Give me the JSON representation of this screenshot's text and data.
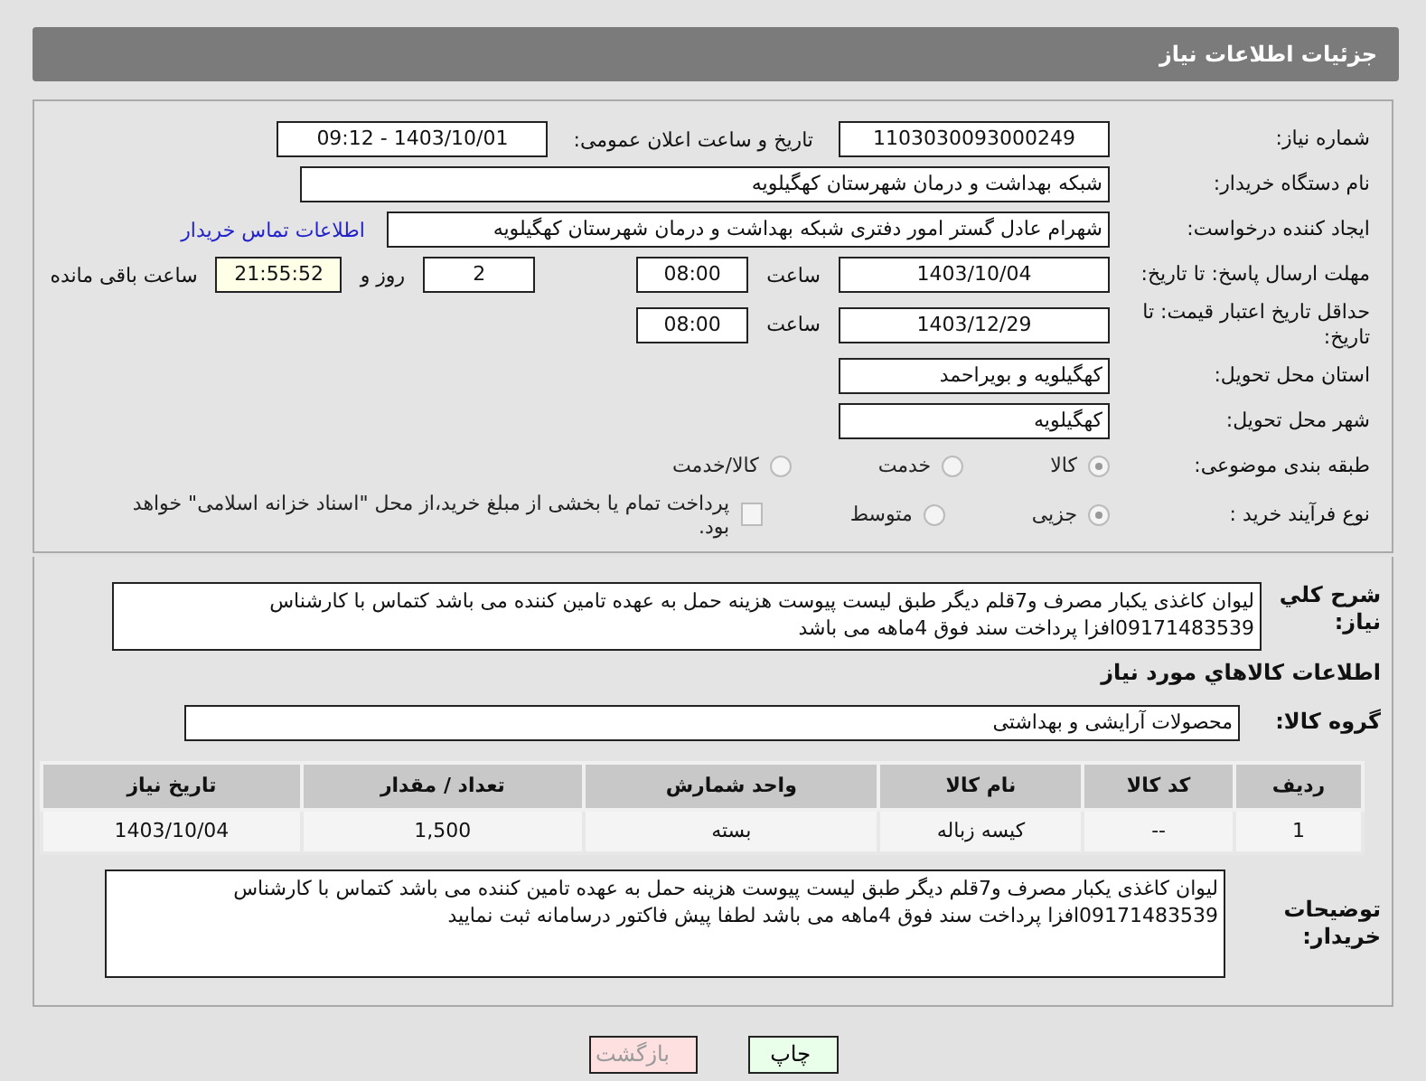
{
  "header": {
    "title": "جزئیات اطلاعات نیاز"
  },
  "need_number": {
    "label": "شماره نیاز:",
    "value": "1103030093000249"
  },
  "announce": {
    "label": "تاریخ و ساعت اعلان عمومی:",
    "value": "1403/10/01 - 09:12"
  },
  "buyer": {
    "label": "نام دستگاه خریدار:",
    "value": "شبکه بهداشت و درمان شهرستان کهگیلویه"
  },
  "creator": {
    "label": "ایجاد کننده درخواست:",
    "value": "شهرام عادل گستر امور دفتری شبکه بهداشت و درمان شهرستان کهگیلویه",
    "link": "اطلاعات تماس خریدار"
  },
  "deadline": {
    "label": "مهلت ارسال پاسخ: تا تاریخ:",
    "date": "1403/10/04",
    "time_label": "ساعت",
    "time": "08:00",
    "days": "2",
    "days_label": "روز و",
    "remaining": "21:55:52",
    "remaining_label": "ساعت باقی مانده"
  },
  "validity": {
    "label": "حداقل تاریخ اعتبار قیمت: تا تاریخ:",
    "date": "1403/12/29",
    "time_label": "ساعت",
    "time": "08:00"
  },
  "province": {
    "label": "استان محل تحویل:",
    "value": "کهگیلویه و بویراحمد"
  },
  "city": {
    "label": "شهر محل تحویل:",
    "value": "کهگیلویه"
  },
  "category": {
    "label": "طبقه بندی موضوعی:",
    "options": [
      {
        "label": "کالا",
        "selected": true
      },
      {
        "label": "خدمت",
        "selected": false
      },
      {
        "label": "کالا/خدمت",
        "selected": false
      }
    ]
  },
  "process": {
    "label": "نوع فرآیند خرید :",
    "options": [
      {
        "label": "جزیی",
        "selected": true
      },
      {
        "label": "متوسط",
        "selected": false
      }
    ],
    "payment": {
      "label": "پرداخت تمام یا بخشی از مبلغ خرید،از محل \"اسناد خزانه اسلامی\" خواهد بود.",
      "checked": false
    }
  },
  "description": {
    "label": "شرح کلي نياز:",
    "text": "لیوان کاغذی یکبار مصرف و7قلم دیگر طبق لیست پیوست هزینه حمل به عهده تامین کننده می باشد کتماس با کارشناس 09171483539افزا پرداخت سند فوق 4ماهه می باشد"
  },
  "goods_title": "اطلاعات كالاهاي مورد نياز",
  "group": {
    "label": "گروه کالا:",
    "value": "محصولات آرایشی و بهداشتی"
  },
  "table": {
    "columns": [
      "ردیف",
      "کد کالا",
      "نام کالا",
      "واحد شمارش",
      "تعداد / مقدار",
      "تاریخ نیاز"
    ],
    "rows": [
      [
        "1",
        "--",
        "کیسه زباله",
        "بسته",
        "1,500",
        "1403/10/04"
      ]
    ]
  },
  "notes": {
    "label": "توضیحات خریدار:",
    "text": "لیوان کاغذی یکبار مصرف و7قلم دیگر طبق لیست پیوست هزینه حمل به عهده تامین کننده می باشد کتماس با کارشناس 09171483539افزا پرداخت سند فوق 4ماهه می باشد لطفا پیش فاکتور درسامانه ثبت نمایید"
  },
  "buttons": [
    {
      "label": "چاپ",
      "kind": "print"
    },
    {
      "label": "بازگشت",
      "kind": "back"
    }
  ]
}
